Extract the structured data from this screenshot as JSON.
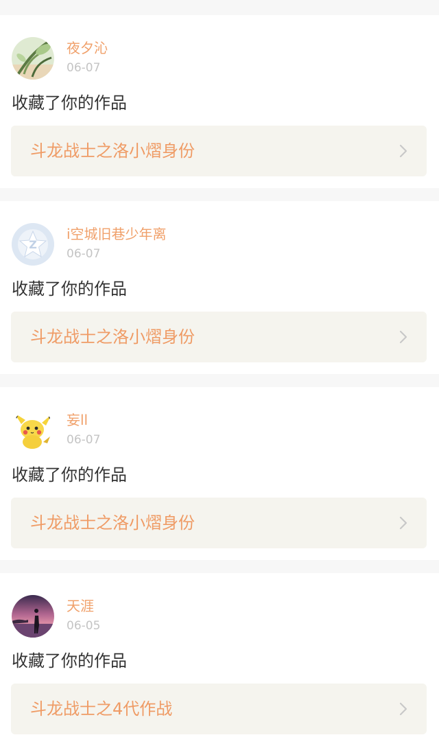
{
  "notifications": [
    {
      "username": "夜夕沁",
      "date": "06-07",
      "action": "收藏了你的作品",
      "work_title": "斗龙战士之洛小熠身份",
      "avatar": "plant-illustration-avatar"
    },
    {
      "username": "i空城旧巷少年离",
      "date": "06-07",
      "action": "收藏了你的作品",
      "work_title": "斗龙战士之洛小熠身份",
      "avatar": "default-star-avatar"
    },
    {
      "username": "妄ll",
      "date": "06-07",
      "action": "收藏了你的作品",
      "work_title": "斗龙战士之洛小熠身份",
      "avatar": "pikachu-avatar"
    },
    {
      "username": "天涯",
      "date": "06-05",
      "action": "收藏了你的作品",
      "work_title": "斗龙战士之4代作战",
      "avatar": "sunset-silhouette-avatar"
    }
  ],
  "colors": {
    "username": "#f0a06a",
    "date": "#c4c4c4",
    "action_text": "#333333",
    "link_bg": "#f5f4ee",
    "link_text": "#ef9b65",
    "chevron": "#c8c8c8",
    "page_bg": "#f7f7f7"
  },
  "icons": {
    "chevron": "chevron-right-icon"
  }
}
